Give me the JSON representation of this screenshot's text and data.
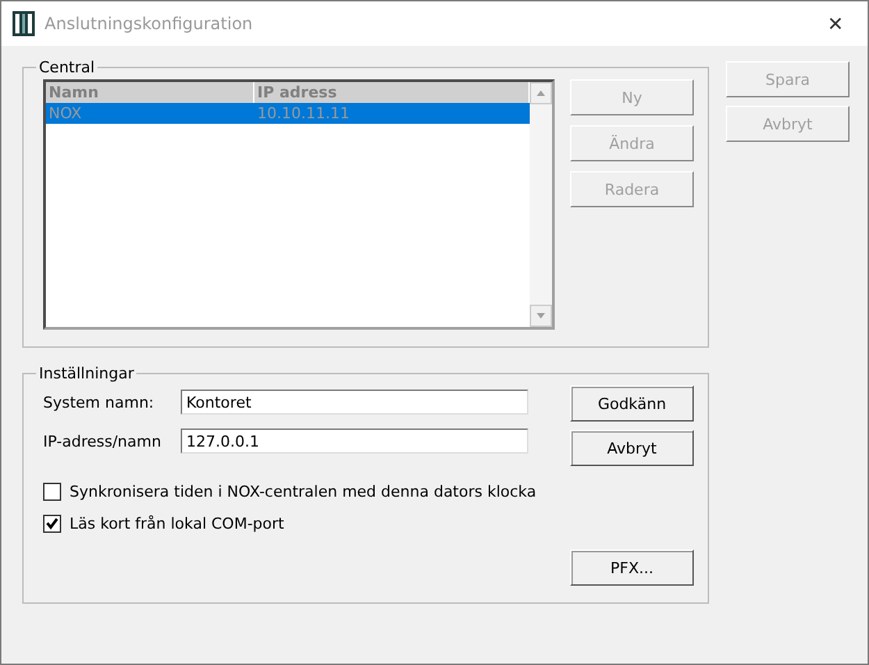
{
  "window": {
    "title": "Anslutningskonfiguration",
    "close": "✕"
  },
  "central": {
    "title": "Central",
    "columns": [
      "Namn",
      "IP adress"
    ],
    "rows": [
      {
        "cells": [
          "NOX",
          "10.10.11.11"
        ],
        "selected": true
      }
    ],
    "buttons": [
      {
        "label": "Ny",
        "disabled": true
      },
      {
        "label": "Ändra",
        "disabled": true
      },
      {
        "label": "Radera",
        "disabled": true
      }
    ]
  },
  "side_buttons": [
    {
      "label": "Spara",
      "disabled": true
    },
    {
      "label": "Avbryt",
      "disabled": true
    }
  ],
  "settings": {
    "title": "Inställningar",
    "fields": [
      {
        "label": "System namn:",
        "value": "Kontoret"
      },
      {
        "label": "IP-adress/namn",
        "value": "127.0.0.1"
      }
    ],
    "buttons": [
      {
        "label": "Godkänn",
        "disabled": false
      },
      {
        "label": "Avbryt",
        "disabled": false
      }
    ],
    "checkboxes": [
      {
        "label": "Synkronisera tiden i NOX-centralen med denna dators klocka",
        "checked": false
      },
      {
        "label": "Läs kort från lokal COM-port",
        "checked": true
      }
    ],
    "pfx_button": {
      "label": "PFX...",
      "disabled": false
    }
  }
}
